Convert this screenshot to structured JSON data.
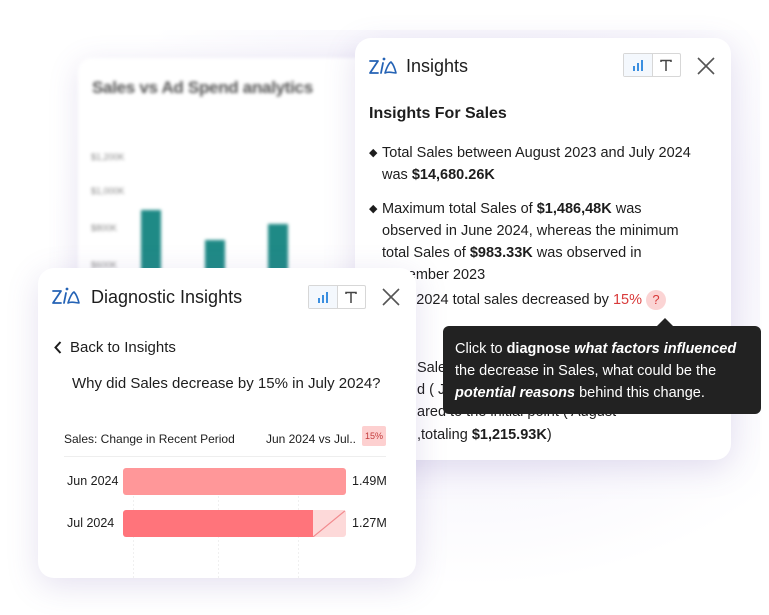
{
  "background_card": {
    "title": "Sales vs Ad Spend analytics",
    "y_ticks": [
      "$1,200K",
      "$1,000K",
      "$800K",
      "$600K"
    ],
    "colors": {
      "sales": "#1f8a86",
      "ad_spend": "#e8902a"
    }
  },
  "insights_panel": {
    "title": "Insights",
    "toggle": {
      "chart_label": "chart-view",
      "text_label": "T"
    },
    "heading": "Insights For Sales",
    "items": [
      {
        "parts": [
          {
            "t": "Total Sales between August 2023 and July 2024 was "
          },
          {
            "t": "$14,680.26K",
            "bold": true
          }
        ]
      },
      {
        "parts": [
          {
            "t": "Maximum total Sales of "
          },
          {
            "t": "$1,486,48K",
            "bold": true
          },
          {
            "t": " was observed in June 2024, whereas the minimum total Sales of "
          },
          {
            "t": "$983.33K",
            "bold": true
          },
          {
            "t": " was observed in November 2023"
          }
        ]
      }
    ],
    "decrease_item": {
      "prefix": "y 2024 total sales decreased by ",
      "value": "15%",
      "help": "?"
    },
    "occluded_fragments": [
      "Sale",
      "d ( Ju",
      "ared to the initial point ( August",
      ",totaling ",
      "$1,215.93K",
      ")"
    ],
    "accent_red": "#d93a3a"
  },
  "tooltip": {
    "parts": [
      {
        "t": "Click to "
      },
      {
        "t": "diagnose",
        "bold": true
      },
      {
        "t": " "
      },
      {
        "t": "what factors influenced",
        "bold": true,
        "italic": true
      },
      {
        "t": " the decrease in Sales, what could be the "
      },
      {
        "t": "potential reasons",
        "bold": true,
        "italic": true
      },
      {
        "t": " behind this change."
      }
    ]
  },
  "diagnostic_panel": {
    "title": "Diagnostic Insights",
    "back_label": "Back to Insights",
    "question": "Why did Sales decrease by 15% in July 2024?",
    "chart": {
      "label": "Sales: Change in Recent Period",
      "comparison": "Jun  2024 vs Jul..",
      "change_badge": "15%"
    }
  },
  "chart_data": {
    "type": "bar",
    "orientation": "horizontal",
    "title": "Sales: Change in Recent Period",
    "categories": [
      "Jun 2024",
      "Jul 2024"
    ],
    "values": [
      1.49,
      1.27
    ],
    "value_labels": [
      "1.49M",
      "1.27M"
    ],
    "unit": "M",
    "change_percent": -15,
    "colors": {
      "jun": "#ff9799",
      "jul": "#ff747b",
      "gap": "#fdd9d9"
    }
  }
}
